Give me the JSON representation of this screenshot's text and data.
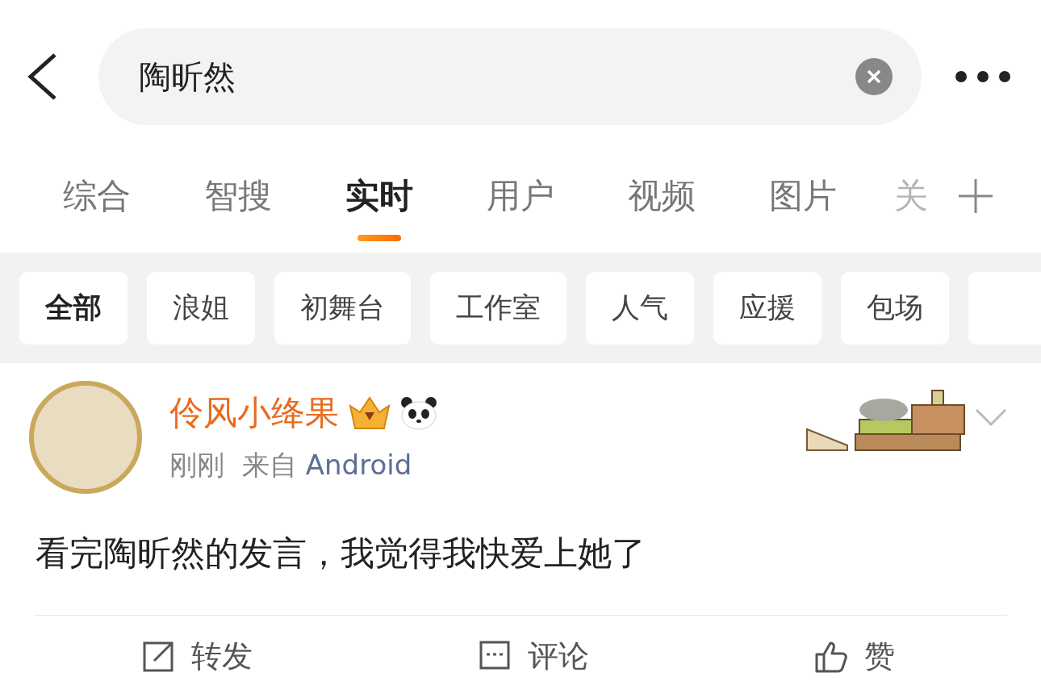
{
  "search": {
    "value": "陶昕然"
  },
  "tabs": [
    {
      "label": "综合",
      "selected": false
    },
    {
      "label": "智搜",
      "selected": false
    },
    {
      "label": "实时",
      "selected": true
    },
    {
      "label": "用户",
      "selected": false
    },
    {
      "label": "视频",
      "selected": false
    },
    {
      "label": "图片",
      "selected": false
    },
    {
      "label": "关",
      "selected": false
    }
  ],
  "filters": [
    {
      "label": "全部",
      "selected": true
    },
    {
      "label": "浪姐",
      "selected": false
    },
    {
      "label": "初舞台",
      "selected": false
    },
    {
      "label": "工作室",
      "selected": false
    },
    {
      "label": "人气",
      "selected": false
    },
    {
      "label": "应援",
      "selected": false
    },
    {
      "label": "包场",
      "selected": false
    }
  ],
  "post": {
    "author": "伶风小绛果",
    "time": "刚刚",
    "source_prefix": "来自",
    "source": "Android",
    "text": "看完陶昕然的发言，我觉得我快爱上她了"
  },
  "actions": [
    {
      "kind": "repost",
      "label": "转发"
    },
    {
      "kind": "comment",
      "label": "评论"
    },
    {
      "kind": "like",
      "label": "赞"
    }
  ]
}
